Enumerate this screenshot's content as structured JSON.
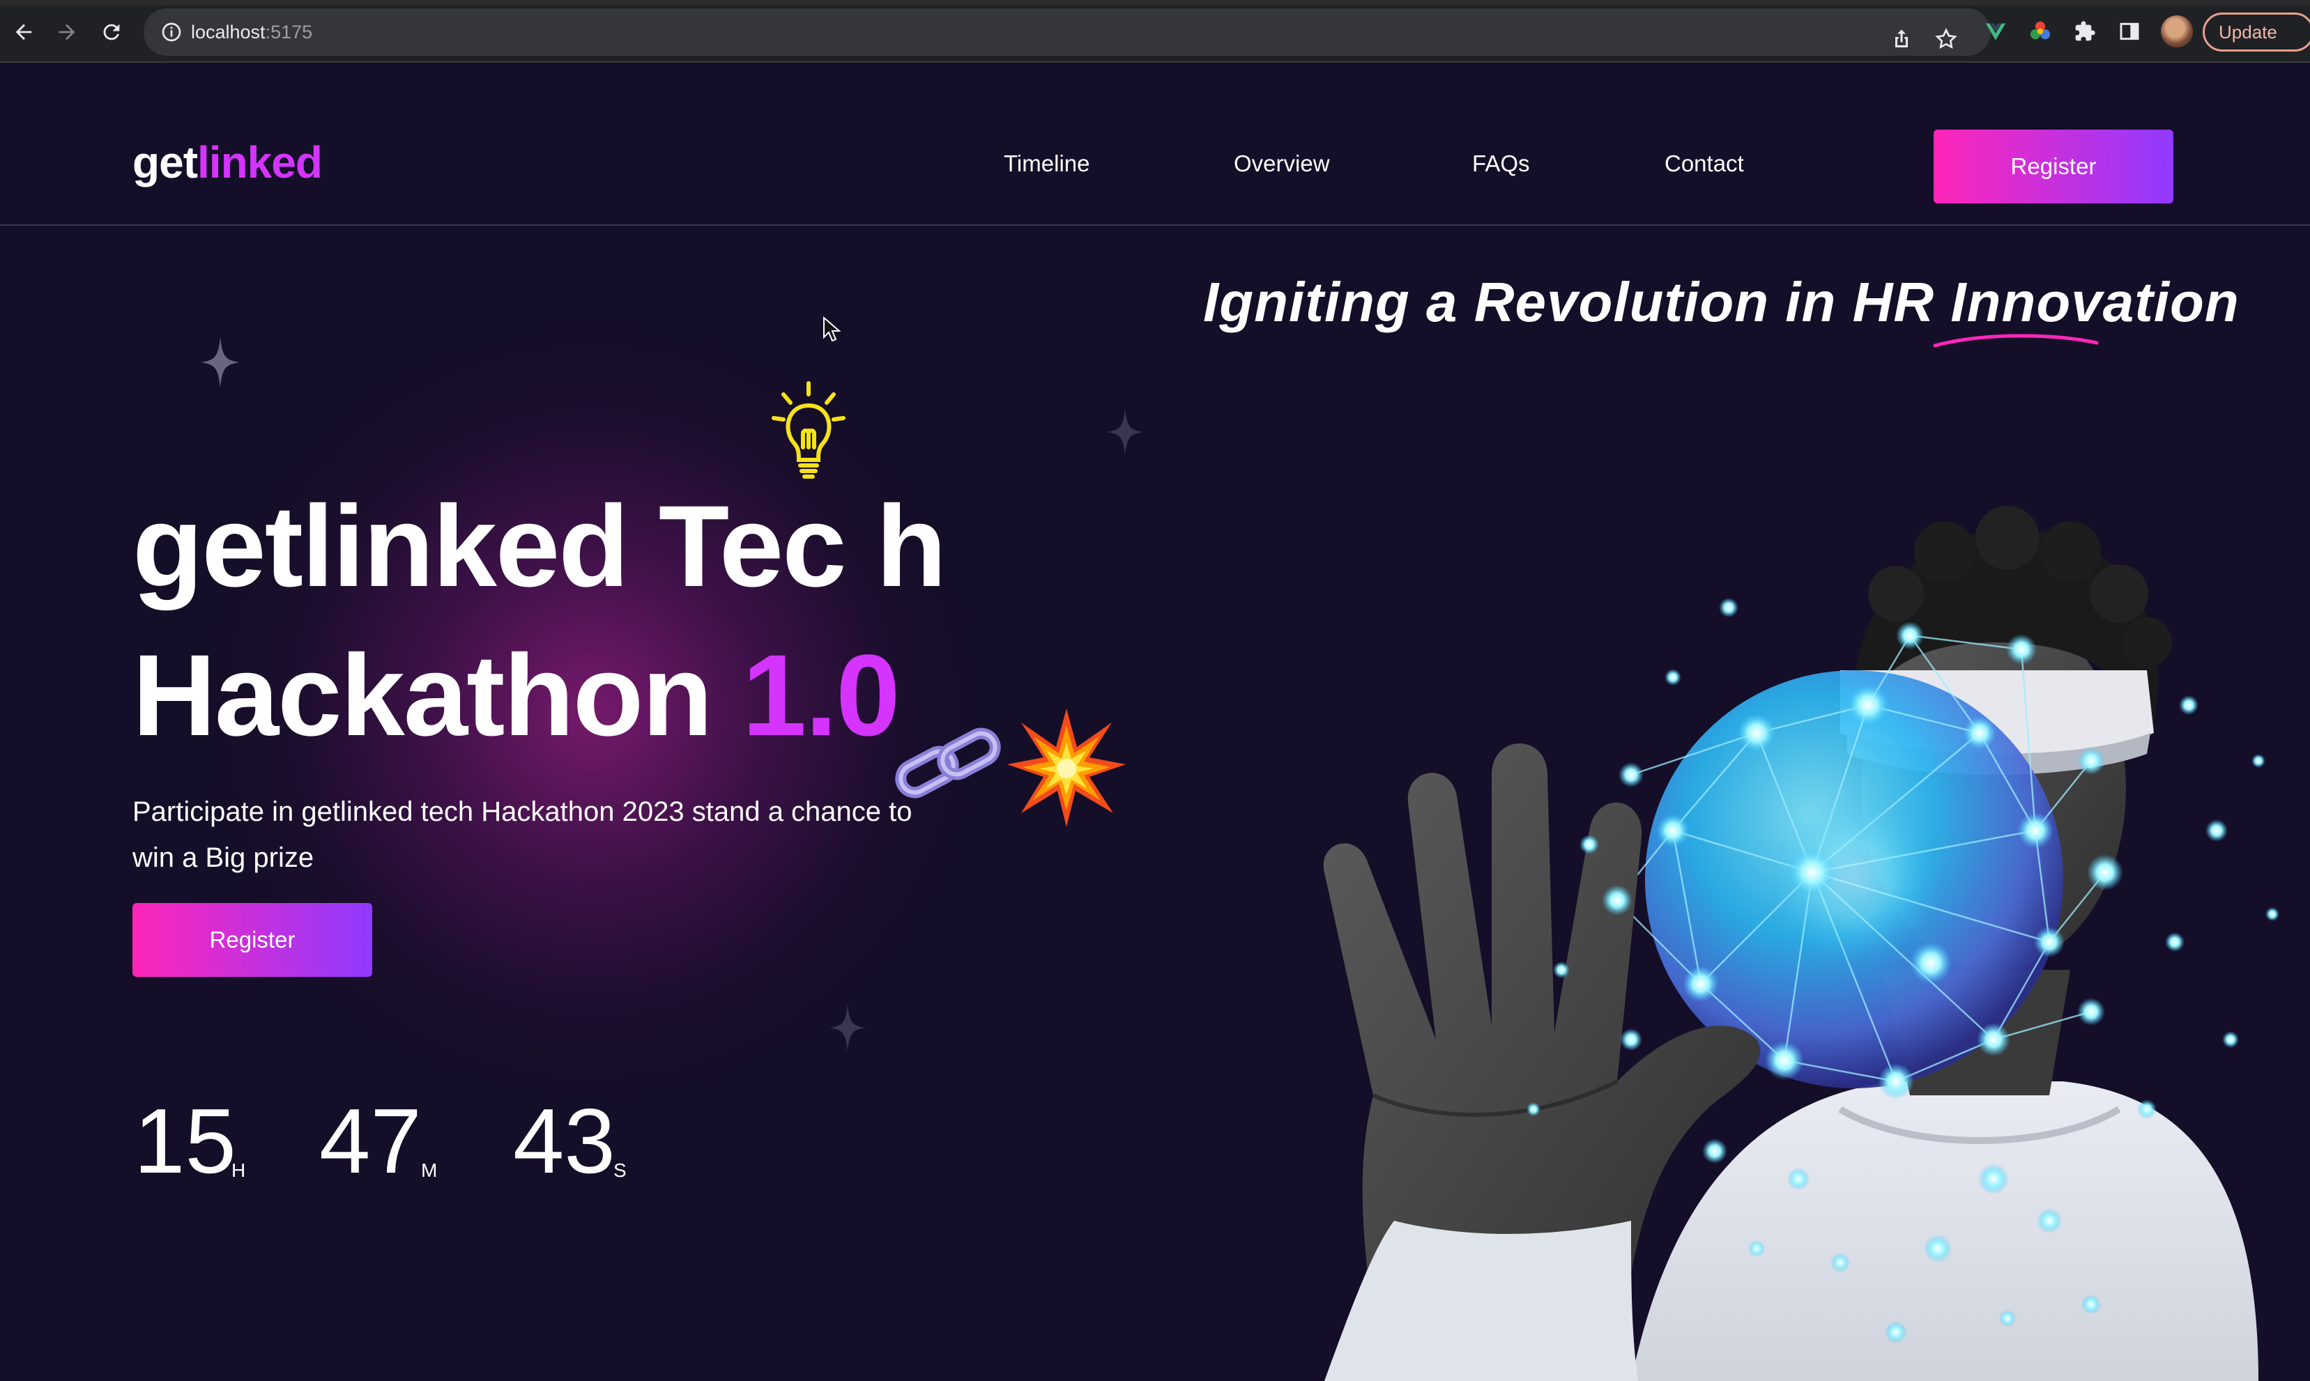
{
  "browser": {
    "url_host": "localhost",
    "url_port": ":5175",
    "update_label": "Update"
  },
  "header": {
    "logo_part1": "get",
    "logo_part2": "linked",
    "nav": [
      {
        "label": "Timeline"
      },
      {
        "label": "Overview"
      },
      {
        "label": "FAQs"
      },
      {
        "label": "Contact"
      }
    ],
    "register_label": "Register"
  },
  "hero": {
    "tagline": "Igniting a Revolution in HR Innovation",
    "title_line1": "getlinked Tec h",
    "title_line2_prefix": "Hackathon ",
    "title_version": "1.0",
    "description": "Participate in getlinked tech Hackathon 2023 stand a chance to win a Big prize",
    "register_label": "Register"
  },
  "countdown": {
    "hours": "15",
    "hours_unit": "H",
    "minutes": "47",
    "minutes_unit": "M",
    "seconds": "43",
    "seconds_unit": "S"
  },
  "colors": {
    "background": "#150e28",
    "accent": "#d434fe",
    "gradient_start": "#ff26b9",
    "gradient_end": "#903aff"
  },
  "icons": [
    "back-arrow-icon",
    "forward-arrow-icon",
    "reload-icon",
    "info-icon",
    "share-icon",
    "star-bookmark-icon",
    "vue-extension-icon",
    "color-extension-icon",
    "puzzle-extensions-icon",
    "side-panel-icon",
    "lightbulb-icon",
    "link-chain-icon",
    "explosion-icon",
    "sparkle-star-icon",
    "cursor-icon"
  ]
}
